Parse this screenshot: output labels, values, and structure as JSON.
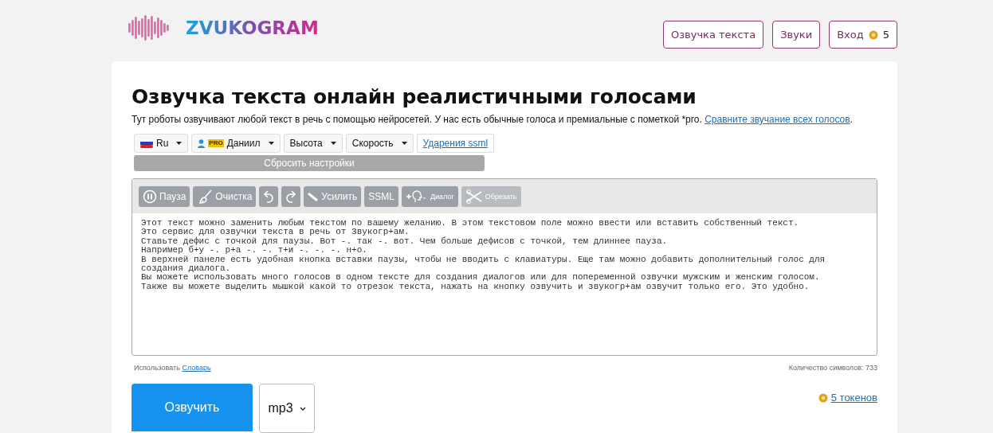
{
  "header": {
    "logo": "ZVUKOGRAM",
    "nav": [
      {
        "label": "Озвучка текста",
        "kind": "text"
      },
      {
        "label": "Звуки",
        "kind": "text"
      },
      {
        "label": "Вход",
        "kind": "coins",
        "count": "5"
      }
    ]
  },
  "title": "Озвучка текста онлайн реалистичными голосами",
  "intro": {
    "text": "Тут роботы озвучивают любой текст в речь с помощью нейросетей. У нас есть обычные голоса и премиальные с пометкой *pro.",
    "link": "Сравните звучание всех голосов",
    "after_link": "."
  },
  "controls": [
    {
      "kind": "flag",
      "label": "Ru"
    },
    {
      "kind": "voice",
      "label": "Даниил",
      "badge": "PRO"
    },
    {
      "kind": "plain",
      "label": "Высота"
    },
    {
      "kind": "plain",
      "label": "Скорость"
    },
    {
      "kind": "link",
      "label": "Ударения ssml"
    }
  ],
  "reset_button": "Сбросить настройки",
  "toolbar": [
    {
      "label": "Пауза",
      "disabled": false
    },
    {
      "label": "Очистка",
      "disabled": false
    },
    {
      "disabled": false
    },
    {
      "disabled": false
    },
    {
      "label": "Усилить",
      "disabled": false
    },
    {
      "label": "SSML",
      "disabled": false
    },
    {
      "label": "Диалог",
      "disabled": false
    },
    {
      "label": "Обрезать",
      "disabled": true
    }
  ],
  "editor_lines": [
    "Этот текст можно заменить любым текстом по вашему желанию. В этом текстовом поле можно ввести или вставить собственный текст.",
    "Это сервис для озвучки текста в речь от Звукогр+ам.",
    "Ставьте дефис с точкой для паузы. Вот -. так -. вот. Чем больше дефисов с точкой, тем длиннее пауза.",
    "Например б+у -. р+а -. -. т+и -. -. -. н+о.",
    "В верхней панеле есть удобная кнопка вставки паузы, чтобы не вводить с клавиатуры. Еще там можно добавить дополнительный голос для",
    "создания диалога.",
    "Вы можете использовать много голосов в одном тексте для создания диалогов или для попеременной озвучки мужским и женским голосом.",
    "Также вы можете выделить мышкой какой то отрезок текста, нажать на кнопку озвучить и звукогр+ам озвучит только его. Это удобно."
  ],
  "dictionary": {
    "text": "Использовать",
    "link": "Словарь"
  },
  "char_count": "Количество символов: 733",
  "speak_button": "Озвучить",
  "format_select": "mp3",
  "tokens": {
    "count": "5",
    "label": "токенов"
  }
}
